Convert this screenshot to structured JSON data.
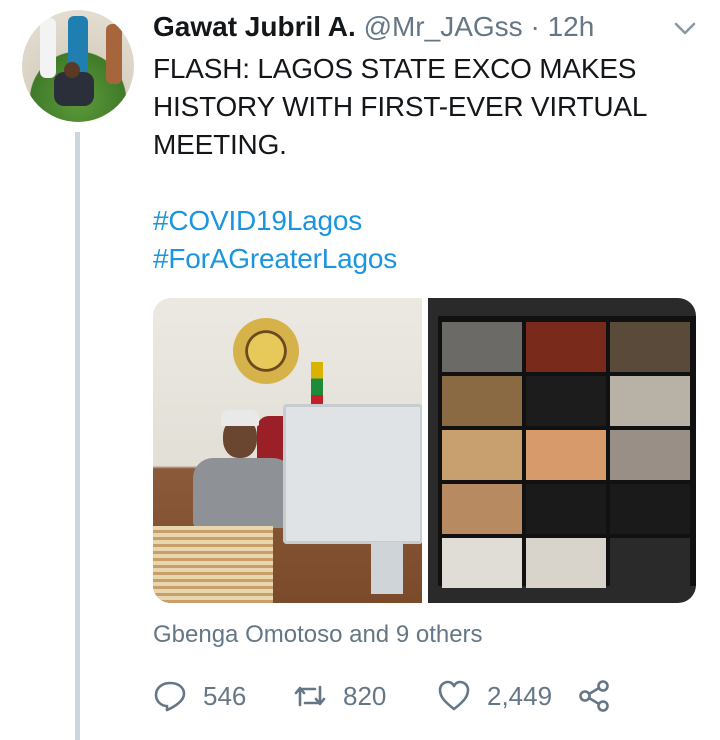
{
  "tweet": {
    "author_name": "Gawat Jubril A.",
    "handle": "@Mr_JAGss",
    "separator": "·",
    "time": "12h",
    "text": "FLASH: LAGOS STATE EXCO MAKES HISTORY WITH FIRST-EVER VIRTUAL MEETING.",
    "hashtags": [
      "#COVID19Lagos",
      "#ForAGreaterLagos"
    ],
    "liked_by": "Gbenga Omotoso and 9 others",
    "counts": {
      "replies": "546",
      "retweets": "820",
      "likes": "2,449"
    }
  },
  "icons": {
    "menu": "chevron-down-icon",
    "reply": "reply-icon",
    "retweet": "retweet-icon",
    "like": "heart-icon",
    "share": "share-icon"
  },
  "colors": {
    "hashtag": "#1b95e0",
    "muted": "#657786",
    "thread_line": "#ccd6dd",
    "text": "#14171a"
  }
}
